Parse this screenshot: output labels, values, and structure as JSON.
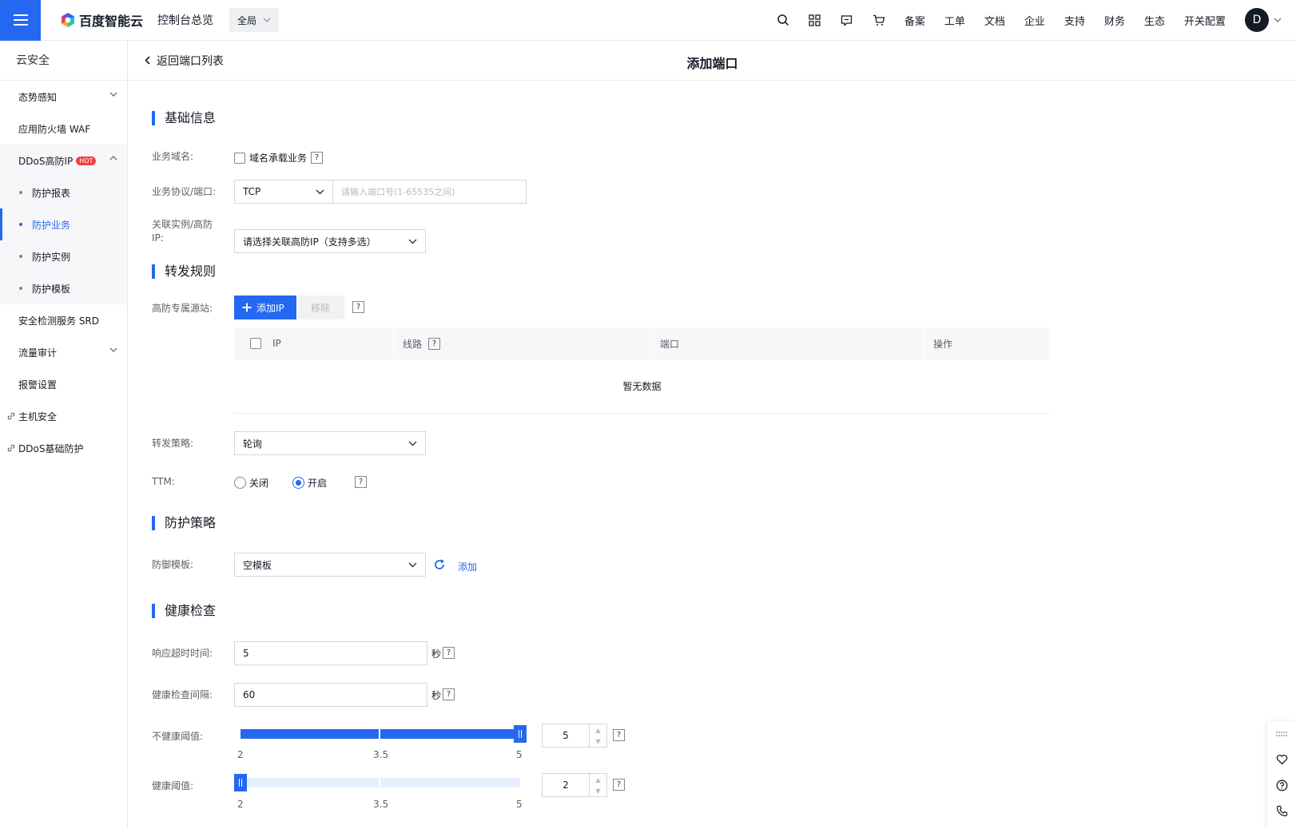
{
  "topbar": {
    "brand": "百度智能云",
    "console": "控制台总览",
    "region": "全局",
    "links": [
      "备案",
      "工单",
      "文档",
      "企业",
      "支持",
      "财务",
      "生态",
      "开关配置"
    ],
    "avatar": "D"
  },
  "sidebar": {
    "title": "云安全",
    "items": [
      {
        "label": "态势感知"
      },
      {
        "label": "应用防火墙 WAF"
      },
      {
        "label": "DDoS高防IP",
        "badge": "HOT"
      },
      {
        "label": "防护报表"
      },
      {
        "label": "防护业务"
      },
      {
        "label": "防护实例"
      },
      {
        "label": "防护模板"
      },
      {
        "label": "安全检测服务 SRD"
      },
      {
        "label": "流量审计"
      },
      {
        "label": "报警设置"
      },
      {
        "label": "主机安全"
      },
      {
        "label": "DDoS基础防护"
      }
    ]
  },
  "header": {
    "back": "返回端口列表",
    "title": "添加端口"
  },
  "basic": {
    "section": "基础信息",
    "domain_label": "业务域名:",
    "domain_checkbox": "域名承载业务",
    "protocol_label": "业务协议/端口:",
    "protocol_value": "TCP",
    "port_placeholder": "请输入端口号(1-65535之间)",
    "instance_label_1": "关联实例/高防",
    "instance_label_2": "IP:",
    "instance_placeholder": "请选择关联高防IP（支持多选）"
  },
  "forward": {
    "section": "转发规则",
    "origin_label": "高防专属源站:",
    "add_ip": "添加IP",
    "remove": "移除",
    "columns": [
      "IP",
      "线路",
      "端口",
      "操作"
    ],
    "empty": "暂无数据",
    "strategy_label": "转发策略:",
    "strategy_value": "轮询",
    "ttm_label": "TTM:",
    "ttm_off": "关闭",
    "ttm_on": "开启",
    "ttm_selected": "开启"
  },
  "protect": {
    "section": "防护策略",
    "template_label": "防御模板:",
    "template_value": "空模板",
    "add": "添加"
  },
  "health": {
    "section": "健康检查",
    "timeout_label": "响应超时时间:",
    "timeout_value": "5",
    "timeout_unit": "秒",
    "interval_label": "健康检查间隔:",
    "interval_value": "60",
    "interval_unit": "秒",
    "unhealthy_label": "不健康阈值:",
    "unhealthy_value": "5",
    "healthy_label": "健康阈值:",
    "healthy_value": "2",
    "slider_min": "2",
    "slider_mid": "3.5",
    "slider_max": "5"
  },
  "colors": {
    "accent": "#2468f2",
    "hot": "#f33e3e"
  },
  "icons": [
    "menu-icon",
    "search-icon",
    "apps-icon",
    "message-icon",
    "cart-icon",
    "chevron-down-icon",
    "chevron-left-icon",
    "plus-icon",
    "refresh-icon",
    "link-icon",
    "heart-icon",
    "help-icon",
    "phone-icon",
    "drag-icon"
  ]
}
